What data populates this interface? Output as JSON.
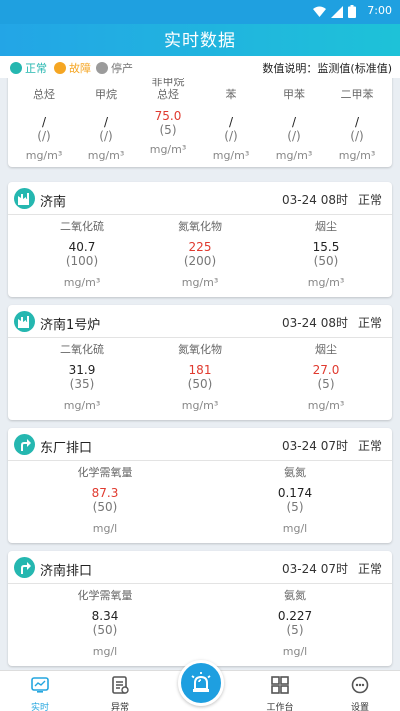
{
  "statusbar": {
    "time": "7:00"
  },
  "appbar": {
    "title": "实时数据"
  },
  "legend": {
    "normal": {
      "label": "正常",
      "color": "#25b7b0"
    },
    "fault": {
      "label": "故障",
      "color": "#f5a623"
    },
    "stopped": {
      "label": "停产",
      "color": "#9b9b9b"
    },
    "note": "数值说明：监测值(标准值)"
  },
  "top_card": {
    "params": [
      {
        "name": "总烃",
        "value": "/",
        "std": "(/)",
        "unit": "mg/m³"
      },
      {
        "name": "甲烷",
        "value": "/",
        "std": "(/)",
        "unit": "mg/m³"
      },
      {
        "name_line1": "非甲烷",
        "name_line2": "总烃",
        "value": "75.0",
        "std": "(5)",
        "unit": "mg/m³",
        "alarm": true
      },
      {
        "name": "苯",
        "value": "/",
        "std": "(/)",
        "unit": "mg/m³"
      },
      {
        "name": "甲苯",
        "value": "/",
        "std": "(/)",
        "unit": "mg/m³"
      },
      {
        "name": "二甲苯",
        "value": "/",
        "std": "(/)",
        "unit": "mg/m³"
      }
    ]
  },
  "cards": [
    {
      "name": "济南",
      "icon": "factory-icon",
      "time": "03-24 08时",
      "status": "正常",
      "params": [
        {
          "name": "二氧化硫",
          "value": "40.7",
          "std": "(100)",
          "unit": "mg/m³",
          "alarm": false
        },
        {
          "name": "氮氧化物",
          "value": "225",
          "std": "(200)",
          "unit": "mg/m³",
          "alarm": true
        },
        {
          "name": "烟尘",
          "value": "15.5",
          "std": "(50)",
          "unit": "mg/m³",
          "alarm": false
        }
      ]
    },
    {
      "name": "济南1号炉",
      "icon": "factory-icon",
      "time": "03-24 08时",
      "status": "正常",
      "params": [
        {
          "name": "二氧化硫",
          "value": "31.9",
          "std": "(35)",
          "unit": "mg/m³",
          "alarm": false
        },
        {
          "name": "氮氧化物",
          "value": "181",
          "std": "(50)",
          "unit": "mg/m³",
          "alarm": true
        },
        {
          "name": "烟尘",
          "value": "27.0",
          "std": "(5)",
          "unit": "mg/m³",
          "alarm": true
        }
      ]
    },
    {
      "name": "东厂排口",
      "icon": "outlet-icon",
      "time": "03-24 07时",
      "status": "正常",
      "params": [
        {
          "name": "化学需氧量",
          "value": "87.3",
          "std": "(50)",
          "unit": "mg/l",
          "alarm": true
        },
        {
          "name": "氨氮",
          "value": "0.174",
          "std": "(5)",
          "unit": "mg/l",
          "alarm": false
        }
      ]
    },
    {
      "name": "济南排口",
      "icon": "outlet-icon",
      "time": "03-24 07时",
      "status": "正常",
      "params": [
        {
          "name": "化学需氧量",
          "value": "8.34",
          "std": "(50)",
          "unit": "mg/l",
          "alarm": false
        },
        {
          "name": "氨氮",
          "value": "0.227",
          "std": "(5)",
          "unit": "mg/l",
          "alarm": false
        }
      ]
    }
  ],
  "tabs": [
    {
      "label": "实时",
      "icon": "monitor-icon",
      "active": true
    },
    {
      "label": "异常",
      "icon": "document-icon",
      "active": false
    },
    {
      "label": "工作台",
      "icon": "grid-icon",
      "active": false
    },
    {
      "label": "设置",
      "icon": "settings-icon",
      "active": false
    }
  ],
  "fab": {
    "icon": "alarm-light-icon"
  }
}
